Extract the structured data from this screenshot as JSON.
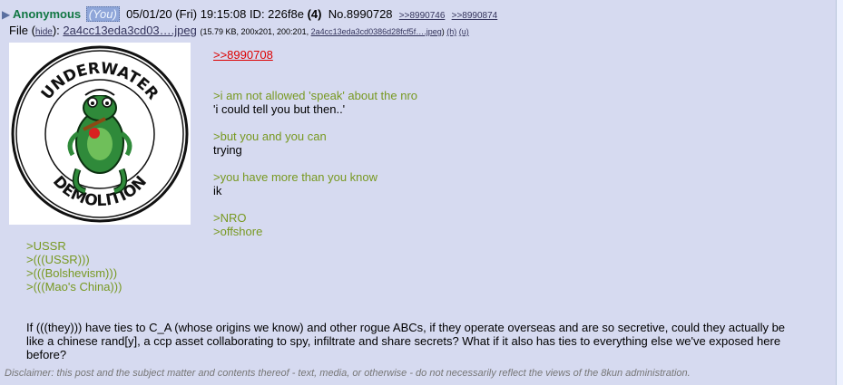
{
  "post": {
    "name": "Anonymous",
    "you_tag": "(You)",
    "datetime": "05/01/20 (Fri) 19:15:08",
    "id_label": "ID: 226f8e",
    "id_count": "(4)",
    "post_no": "No.8990728",
    "backlinks": [
      ">>8990746",
      ">>8990874"
    ]
  },
  "file": {
    "label": "File",
    "hide_open": "(",
    "hide": "hide",
    "hide_close": "):",
    "filename": "2a4cc13eda3cd03….jpeg",
    "details_prefix": "(15.79 KB, 200x201, 200:201,",
    "details_link": "2a4cc13eda3cd0386d28fcf5f….jpeg",
    "details_suffix": ")",
    "h_link": "(h)",
    "u_link": "(u)"
  },
  "thumb": {
    "text_top": "UNDERWATER",
    "text_bottom": "DEMOLITION"
  },
  "body": {
    "reply": ">>8990708",
    "lines": [
      {
        "t": "",
        "quote": false
      },
      {
        "t": "",
        "quote": false
      },
      {
        "t": ">i am not allowed 'speak' about the nro",
        "quote": true
      },
      {
        "t": "'i could tell you but then..'",
        "quote": false
      },
      {
        "t": "",
        "quote": false
      },
      {
        "t": ">but you and you can",
        "quote": true
      },
      {
        "t": "trying",
        "quote": false
      },
      {
        "t": "",
        "quote": false
      },
      {
        "t": ">you have more than you know",
        "quote": true
      },
      {
        "t": "ik",
        "quote": false
      },
      {
        "t": "",
        "quote": false
      },
      {
        "t": ">NRO",
        "quote": true
      },
      {
        "t": ">offshore",
        "quote": true
      }
    ],
    "below_quotes": [
      ">USSR",
      ">(((USSR)))",
      ">(((Bolshevism)))",
      ">(((Mao's China)))"
    ],
    "paragraph": "If (((they))) have ties to C_A (whose origins we know) and other rogue ABCs, if they operate overseas and are so secretive, could they actually be like a chinese rand[y], a ccp asset collaborating to spy, infiltrate and share secrets? What if it also has ties to everything else we've exposed here before?"
  },
  "disclaimer": "Disclaimer: this post and the subject matter and contents thereof - text, media, or otherwise - do not necessarily reflect the views of the 8kun administration."
}
